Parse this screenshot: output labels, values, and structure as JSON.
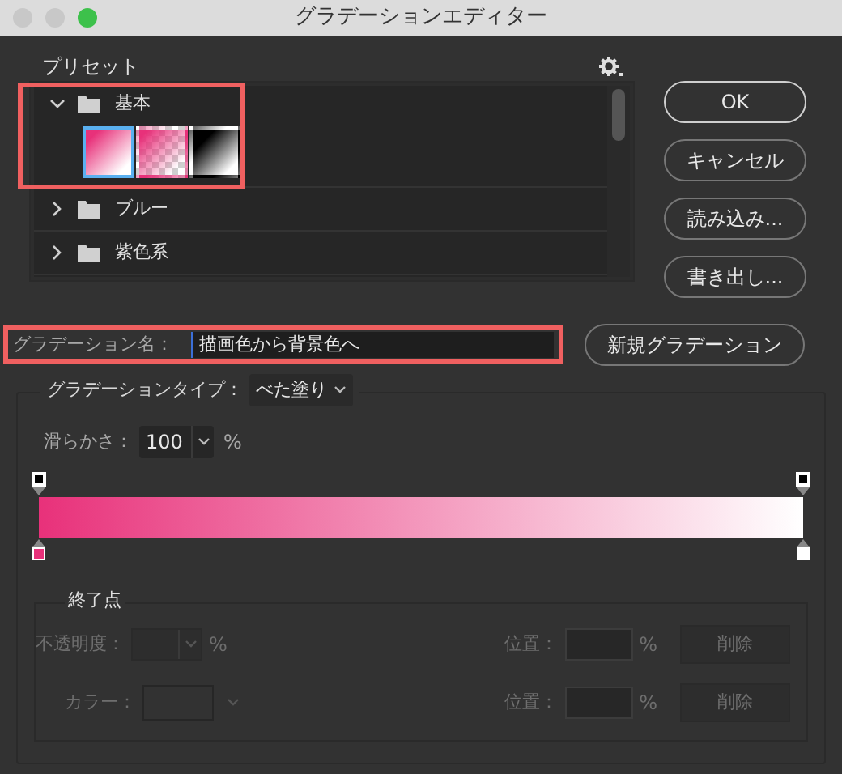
{
  "window": {
    "title": "グラデーションエディター"
  },
  "presets": {
    "label": "プリセット",
    "groups": [
      {
        "name": "基本",
        "expanded": true,
        "highlighted": true,
        "swatches": [
          {
            "kind": "fg-bg",
            "selected": true
          },
          {
            "kind": "fg-transparent",
            "selected": false
          },
          {
            "kind": "black-white",
            "selected": false
          }
        ]
      },
      {
        "name": "ブルー",
        "expanded": false,
        "highlighted": false
      },
      {
        "name": "紫色系",
        "expanded": false,
        "highlighted": false
      }
    ]
  },
  "buttons": [
    "OK",
    "キャンセル",
    "読み込み...",
    "書き出し..."
  ],
  "name_field": {
    "label": "グラデーション名：",
    "value": "描画色から背景色へ",
    "highlighted": true
  },
  "new_button": "新規グラデーション",
  "gradient_type": {
    "label": "グラデーションタイプ：",
    "value": "べた塗り"
  },
  "smoothness": {
    "label": "滑らかさ：",
    "value": "100",
    "unit": "%"
  },
  "gradient": {
    "opacity_stops": [
      {
        "color": "#000000"
      },
      {
        "color": "#000000"
      }
    ],
    "color_stops": [
      {
        "color": "#e8317a"
      },
      {
        "color": "#ffffff"
      }
    ]
  },
  "stops_section": {
    "title": "終了点",
    "disabled": true,
    "rows": [
      {
        "kind": "opacity",
        "label": "不透明度：",
        "unit": "%",
        "position_label": "位置：",
        "position_unit": "%",
        "delete": "削除"
      },
      {
        "kind": "color",
        "label": "カラー：",
        "position_label": "位置：",
        "position_unit": "%",
        "delete": "削除"
      }
    ]
  }
}
